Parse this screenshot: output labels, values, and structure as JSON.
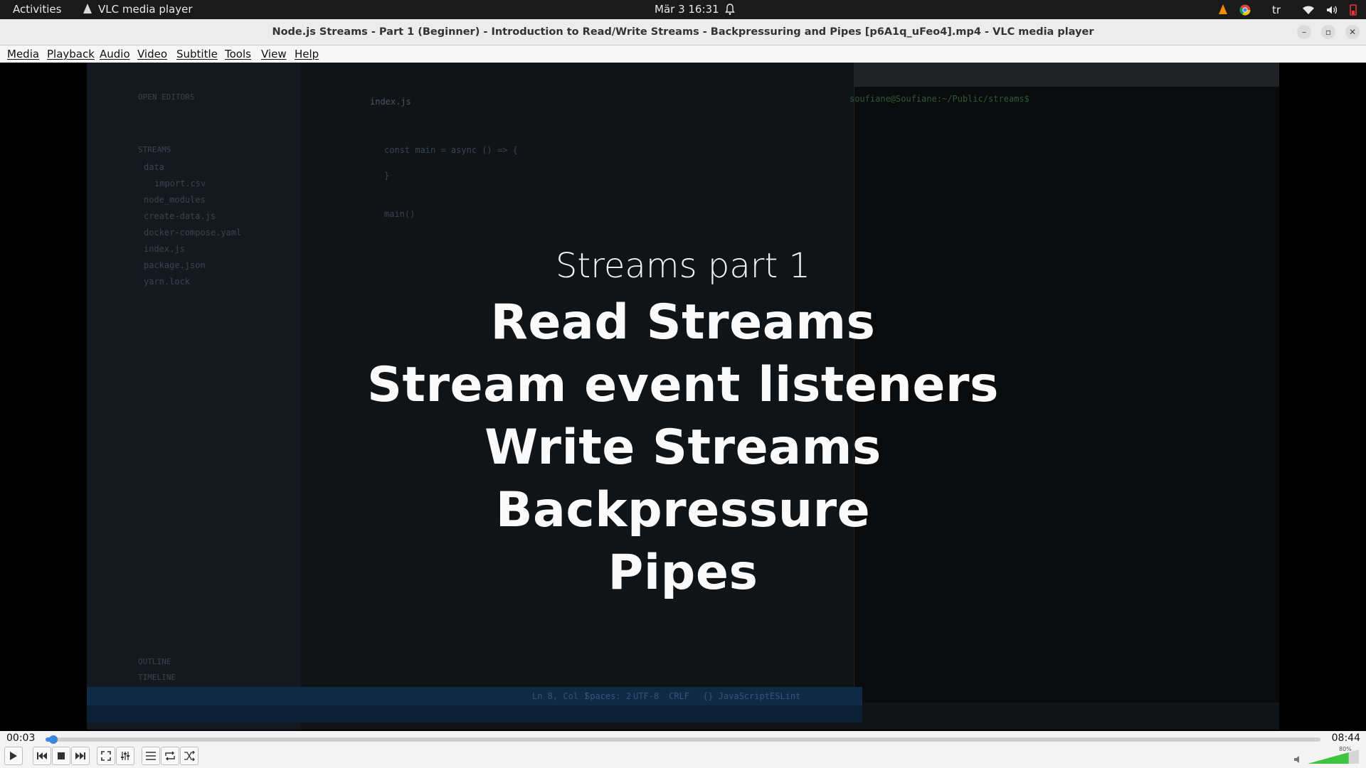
{
  "topbar": {
    "activities": "Activities",
    "app_name": "VLC media player",
    "clock": "Mär 3  16:31",
    "keyboard_layout": "tr"
  },
  "window": {
    "title": "Node.js Streams - Part 1 (Beginner) - Introduction to Read/Write Streams - Backpressuring and Pipes [p6A1q_uFeo4].mp4 - VLC media player"
  },
  "menu": {
    "items": [
      "Media",
      "Playback",
      "Audio",
      "Video",
      "Subtitle",
      "Tools",
      "View",
      "Help"
    ]
  },
  "video_overlay": {
    "subtitle": "Streams part 1",
    "lines": [
      "Read Streams",
      "Stream event listeners",
      "Write Streams",
      "Backpressure",
      "Pipes"
    ]
  },
  "video_background": {
    "editor_tab": "index.js",
    "sidebar_section": "OPEN EDITORS",
    "project": "STREAMS",
    "files": [
      "data",
      "import.csv",
      "node_modules",
      "create-data.js",
      "docker-compose.yaml",
      "index.js",
      "package.json",
      "yarn.lock"
    ],
    "code_lines": [
      "const main = async () => {",
      "}",
      "main()"
    ],
    "terminal_prompt": "soufiane@Soufiane:~/Public/streams$",
    "outline": "OUTLINE",
    "timeline": "TIMELINE",
    "status_items": [
      "Ln 8, Col 1",
      "Spaces: 2",
      "UTF-8",
      "CRLF",
      "{} JavaScript",
      "ESLint"
    ]
  },
  "playback": {
    "current_time": "00:03",
    "total_time": "08:44",
    "progress_fraction": 0.006,
    "volume_percent": 80,
    "volume_label": "80%"
  },
  "colors": {
    "accent": "#3b86e3",
    "vlc_orange": "#f08c00",
    "volume_green": "#3ec43e"
  },
  "icons": {
    "play": "play-icon",
    "prev": "skip-back-icon",
    "stop": "stop-icon",
    "next": "skip-forward-icon",
    "fullscreen": "fullscreen-icon",
    "extended": "equalizer-icon",
    "playlist": "playlist-icon",
    "loop": "loop-icon",
    "shuffle": "shuffle-icon"
  }
}
